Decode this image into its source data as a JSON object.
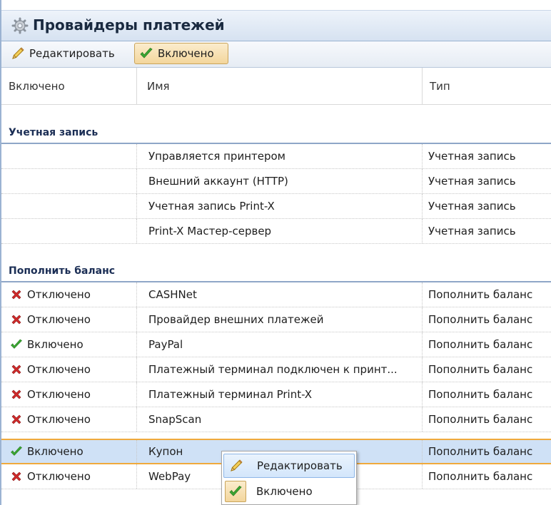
{
  "panel": {
    "title": "Провайдеры платежей"
  },
  "toolbar": {
    "edit_label": "Редактировать",
    "enabled_label": "Включено"
  },
  "columns": {
    "enabled": "Включено",
    "name": "Имя",
    "type": "Тип"
  },
  "groups": {
    "account": "Учетная запись",
    "topup": "Пополнить баланс"
  },
  "account_rows": [
    {
      "name": "Управляется принтером",
      "type": "Учетная запись"
    },
    {
      "name": "Внешний аккаунт (HTTP)",
      "type": "Учетная запись"
    },
    {
      "name": "Учетная запись Print-X",
      "type": "Учетная запись"
    },
    {
      "name": "Print-X Мастер-сервер",
      "type": "Учетная запись"
    }
  ],
  "topup_rows": [
    {
      "status": "Отключено",
      "icon": "cross-icon",
      "name": "CASHNet",
      "type": "Пополнить баланс"
    },
    {
      "status": "Отключено",
      "icon": "cross-icon",
      "name": "Провайдер внешних платежей",
      "type": "Пополнить баланс"
    },
    {
      "status": "Включено",
      "icon": "check-icon",
      "name": "PayPal",
      "type": "Пополнить баланс"
    },
    {
      "status": "Отключено",
      "icon": "cross-icon",
      "name": "Платежный терминал подключен к принт...",
      "type": "Пополнить баланс"
    },
    {
      "status": "Отключено",
      "icon": "cross-icon",
      "name": "Платежный терминал Print-X",
      "type": "Пополнить баланс"
    },
    {
      "status": "Отключено",
      "icon": "cross-icon",
      "name": "SnapScan",
      "type": "Пополнить баланс"
    },
    {
      "status": "Включено",
      "icon": "check-icon",
      "name": "Купон",
      "type": "Пополнить баланс"
    },
    {
      "status": "Отключено",
      "icon": "cross-icon",
      "name": "WebPay",
      "type": "Пополнить баланс"
    }
  ],
  "context_menu": {
    "edit_label": "Редактировать",
    "enabled_label": "Включено"
  },
  "colors": {
    "accent": "#f0a93c",
    "selection": "#cfe1f6",
    "group_text": "#1b2e55",
    "check": "#3aa832",
    "cross": "#d02a2a"
  }
}
